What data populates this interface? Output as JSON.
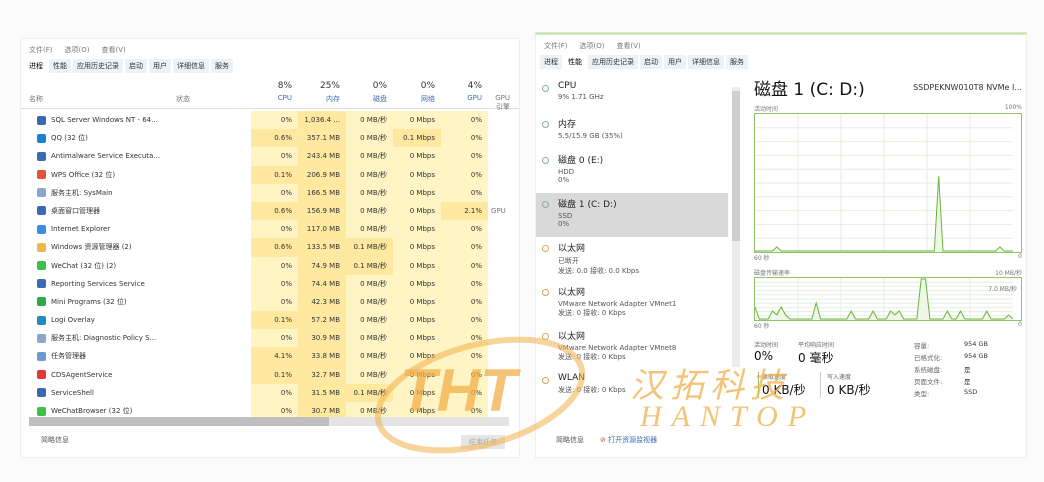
{
  "left_window": {
    "menu": [
      "文件(F)",
      "选项(O)",
      "查看(V)"
    ],
    "tabs": [
      "进程",
      "性能",
      "应用历史记录",
      "启动",
      "用户",
      "详细信息",
      "服务"
    ],
    "active_tab": 0,
    "columns": [
      {
        "pct": "",
        "label": "名称"
      },
      {
        "pct": "",
        "label": "状态"
      },
      {
        "pct": "8%",
        "label": "CPU"
      },
      {
        "pct": "25%",
        "label": "内存"
      },
      {
        "pct": "0%",
        "label": "磁盘"
      },
      {
        "pct": "0%",
        "label": "网络"
      },
      {
        "pct": "4%",
        "label": "GPU"
      },
      {
        "pct": "",
        "label": "GPU 引擎"
      }
    ],
    "rows": [
      {
        "name": "SQL Server Windows NT - 64...",
        "icon": "#3a6bb0",
        "cpu": "0%",
        "mem": "1,036.4 ...",
        "disk": "0 MB/秒",
        "net": "0 Mbps",
        "gpu": "0%",
        "eng": ""
      },
      {
        "name": "QQ (32 位)",
        "icon": "#1e7fd8",
        "cpu": "0.6%",
        "mem": "357.1 MB",
        "disk": "0 MB/秒",
        "net": "0.1 Mbps",
        "gpu": "0%",
        "eng": ""
      },
      {
        "name": "Antimalware Service Executa...",
        "icon": "#3a6bb0",
        "cpu": "0%",
        "mem": "243.4 MB",
        "disk": "0 MB/秒",
        "net": "0 Mbps",
        "gpu": "0%",
        "eng": ""
      },
      {
        "name": "WPS Office (32 位)",
        "icon": "#e0553a",
        "cpu": "0.1%",
        "mem": "206.9 MB",
        "disk": "0 MB/秒",
        "net": "0 Mbps",
        "gpu": "0%",
        "eng": ""
      },
      {
        "name": "服务主机: SysMain",
        "icon": "#8aa8c8",
        "cpu": "0%",
        "mem": "166.5 MB",
        "disk": "0 MB/秒",
        "net": "0 Mbps",
        "gpu": "0%",
        "eng": ""
      },
      {
        "name": "桌面窗口管理器",
        "icon": "#3a6bb0",
        "cpu": "0.6%",
        "mem": "156.9 MB",
        "disk": "0 MB/秒",
        "net": "0 Mbps",
        "gpu": "2.1%",
        "eng": "GPU"
      },
      {
        "name": "Internet Explorer",
        "icon": "#3d8de0",
        "cpu": "0%",
        "mem": "117.0 MB",
        "disk": "0 MB/秒",
        "net": "0 Mbps",
        "gpu": "0%",
        "eng": ""
      },
      {
        "name": "Windows 资源管理器 (2)",
        "icon": "#e8b84a",
        "cpu": "0.6%",
        "mem": "133.5 MB",
        "disk": "0.1 MB/秒",
        "net": "0 Mbps",
        "gpu": "0%",
        "eng": ""
      },
      {
        "name": "WeChat (32 位) (2)",
        "icon": "#3fbf4a",
        "cpu": "0%",
        "mem": "74.9 MB",
        "disk": "0.1 MB/秒",
        "net": "0 Mbps",
        "gpu": "0%",
        "eng": ""
      },
      {
        "name": "Reporting Services Service",
        "icon": "#3a6bb0",
        "cpu": "0%",
        "mem": "74.4 MB",
        "disk": "0 MB/秒",
        "net": "0 Mbps",
        "gpu": "0%",
        "eng": ""
      },
      {
        "name": "Mini Programs (32 位)",
        "icon": "#2fa84a",
        "cpu": "0%",
        "mem": "42.3 MB",
        "disk": "0 MB/秒",
        "net": "0 Mbps",
        "gpu": "0%",
        "eng": ""
      },
      {
        "name": "Logi Overlay",
        "icon": "#1a8fc0",
        "cpu": "0.1%",
        "mem": "57.2 MB",
        "disk": "0 MB/秒",
        "net": "0 Mbps",
        "gpu": "0%",
        "eng": ""
      },
      {
        "name": "服务主机: Diagnostic Policy S...",
        "icon": "#8aa8c8",
        "cpu": "0%",
        "mem": "30.9 MB",
        "disk": "0 MB/秒",
        "net": "0 Mbps",
        "gpu": "0%",
        "eng": ""
      },
      {
        "name": "任务管理器",
        "icon": "#6a9ad0",
        "cpu": "4.1%",
        "mem": "33.8 MB",
        "disk": "0 MB/秒",
        "net": "0 Mbps",
        "gpu": "0%",
        "eng": ""
      },
      {
        "name": "CDSAgentService",
        "icon": "#e03a3a",
        "cpu": "0.1%",
        "mem": "32.7 MB",
        "disk": "0 MB/秒",
        "net": "0 Mbps",
        "gpu": "0%",
        "eng": ""
      },
      {
        "name": "ServiceShell",
        "icon": "#3a6bb0",
        "cpu": "0%",
        "mem": "31.5 MB",
        "disk": "0.1 MB/秒",
        "net": "0 Mbps",
        "gpu": "0%",
        "eng": ""
      },
      {
        "name": "WeChatBrowser (32 位)",
        "icon": "#3fbf4a",
        "cpu": "0%",
        "mem": "30.7 MB",
        "disk": "0 MB/秒",
        "net": "0 Mbps",
        "gpu": "0%",
        "eng": ""
      }
    ],
    "footer": "简略信息",
    "end_task": "结束任务"
  },
  "right_window": {
    "menu": [
      "文件(F)",
      "选项(O)",
      "查看(V)"
    ],
    "tabs": [
      "进程",
      "性能",
      "应用历史记录",
      "启动",
      "用户",
      "详细信息",
      "服务"
    ],
    "active_tab": 1,
    "side": [
      {
        "title": "CPU",
        "l1": "9% 1.71 GHz",
        "l2": ""
      },
      {
        "title": "内存",
        "l1": "5.5/15.9 GB (35%)",
        "l2": ""
      },
      {
        "title": "磁盘 0 (E:)",
        "l1": "HDD",
        "l2": "0%"
      },
      {
        "title": "磁盘 1 (C: D:)",
        "l1": "SSD",
        "l2": "0%"
      },
      {
        "title": "以太网",
        "l1": "已断开",
        "l2": "发送: 0.0 接收: 0.0 Kbps"
      },
      {
        "title": "以太网",
        "l1": "VMware Network Adapter VMnet1",
        "l2": "发送: 0 接收: 0 Kbps"
      },
      {
        "title": "以太网",
        "l1": "VMware Network Adapter VMnet8",
        "l2": "发送: 0 接收: 0 Kbps"
      },
      {
        "title": "WLAN",
        "l1": "",
        "l2": "发送: 0 接收: 0 Kbps"
      }
    ],
    "selected": 3,
    "detail": {
      "title": "磁盘 1 (C: D:)",
      "model": "SSDPEKNW010T8 NVMe I...",
      "chart1_label": "活动时间",
      "chart1_max": "100%",
      "time_label": "60 秒",
      "zero": "0",
      "chart2_label": "磁盘传输速率",
      "chart2_max": "10 MB/秒",
      "chart2_inner": "7.0 MB/秒",
      "active_label": "活动时间",
      "active_val": "0%",
      "resp_label": "平均响应时间",
      "resp_val": "0 毫秒",
      "read_label": "读取速度",
      "read_val": "0 KB/秒",
      "write_label": "写入速度",
      "write_val": "0 KB/秒",
      "props": [
        [
          "容量:",
          "954 GB"
        ],
        [
          "已格式化:",
          "954 GB"
        ],
        [
          "系统磁盘:",
          "是"
        ],
        [
          "页面文件:",
          "是"
        ],
        [
          "类型:",
          "SSD"
        ]
      ]
    },
    "footer": "简略信息",
    "resmon": "打开资源监视器"
  },
  "chart_data": [
    {
      "type": "line",
      "title": "活动时间",
      "ylim": [
        0,
        100
      ],
      "values": [
        0,
        0,
        0,
        0,
        0,
        3,
        0,
        0,
        0,
        0,
        0,
        0,
        0,
        0,
        0,
        0,
        0,
        0,
        0,
        0,
        0,
        0,
        0,
        0,
        0,
        0,
        0,
        0,
        0,
        0,
        0,
        0,
        0,
        0,
        0,
        0,
        0,
        0,
        0,
        0,
        0,
        0,
        55,
        0,
        0,
        0,
        0,
        0,
        0,
        0,
        0,
        0,
        0,
        0,
        0,
        0,
        3,
        0,
        0,
        0
      ]
    },
    {
      "type": "line",
      "title": "磁盘传输速率",
      "ylim": [
        0,
        10
      ],
      "values": [
        3,
        0,
        0,
        0,
        2,
        1,
        3,
        1,
        0,
        0,
        0,
        0,
        0,
        0,
        4,
        0,
        0,
        0,
        0,
        0,
        0,
        0,
        2,
        0,
        0,
        0,
        0,
        2,
        0,
        0,
        0,
        2,
        1,
        2,
        0,
        0,
        0,
        0,
        10,
        10,
        0,
        0,
        0,
        0,
        2,
        0,
        0,
        2,
        0,
        0,
        0,
        0,
        0,
        2,
        0,
        0,
        0,
        0,
        1,
        0
      ]
    }
  ],
  "watermark": {
    "logo": "THT",
    "cn": "汉拓科技",
    "en": "HANTOP"
  }
}
